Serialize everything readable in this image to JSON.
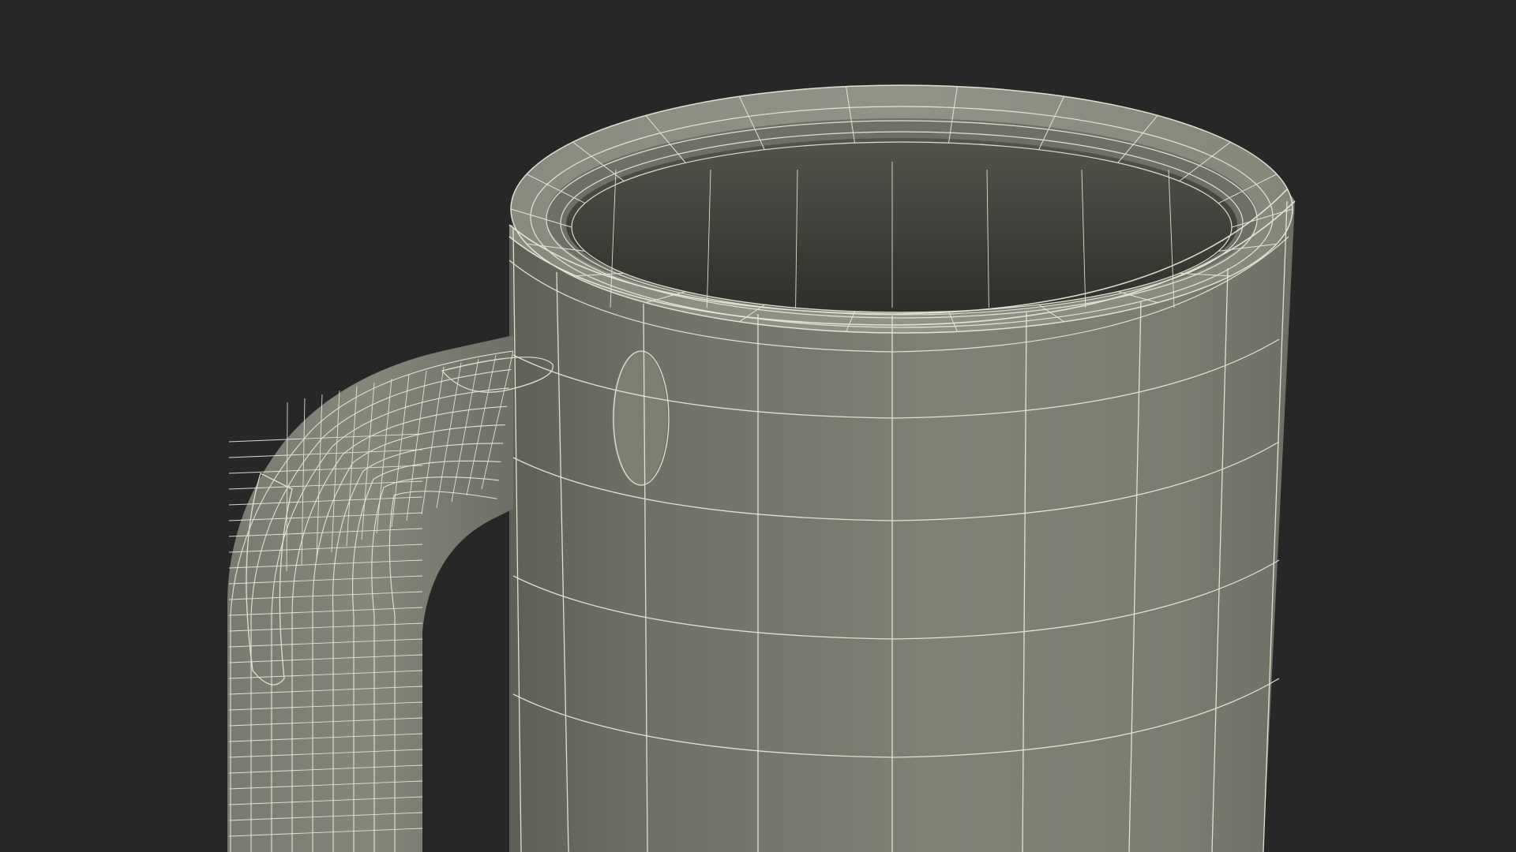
{
  "scene": {
    "subject": "mug-wireframe",
    "colors": {
      "background": "#262727",
      "body_light": "#7f7f74",
      "body_mid": "#76766c",
      "body_dark": "#5d5e55",
      "interior_dark": "#2f302b",
      "interior_mid": "#45463f",
      "wire": "#eeeedd"
    }
  }
}
